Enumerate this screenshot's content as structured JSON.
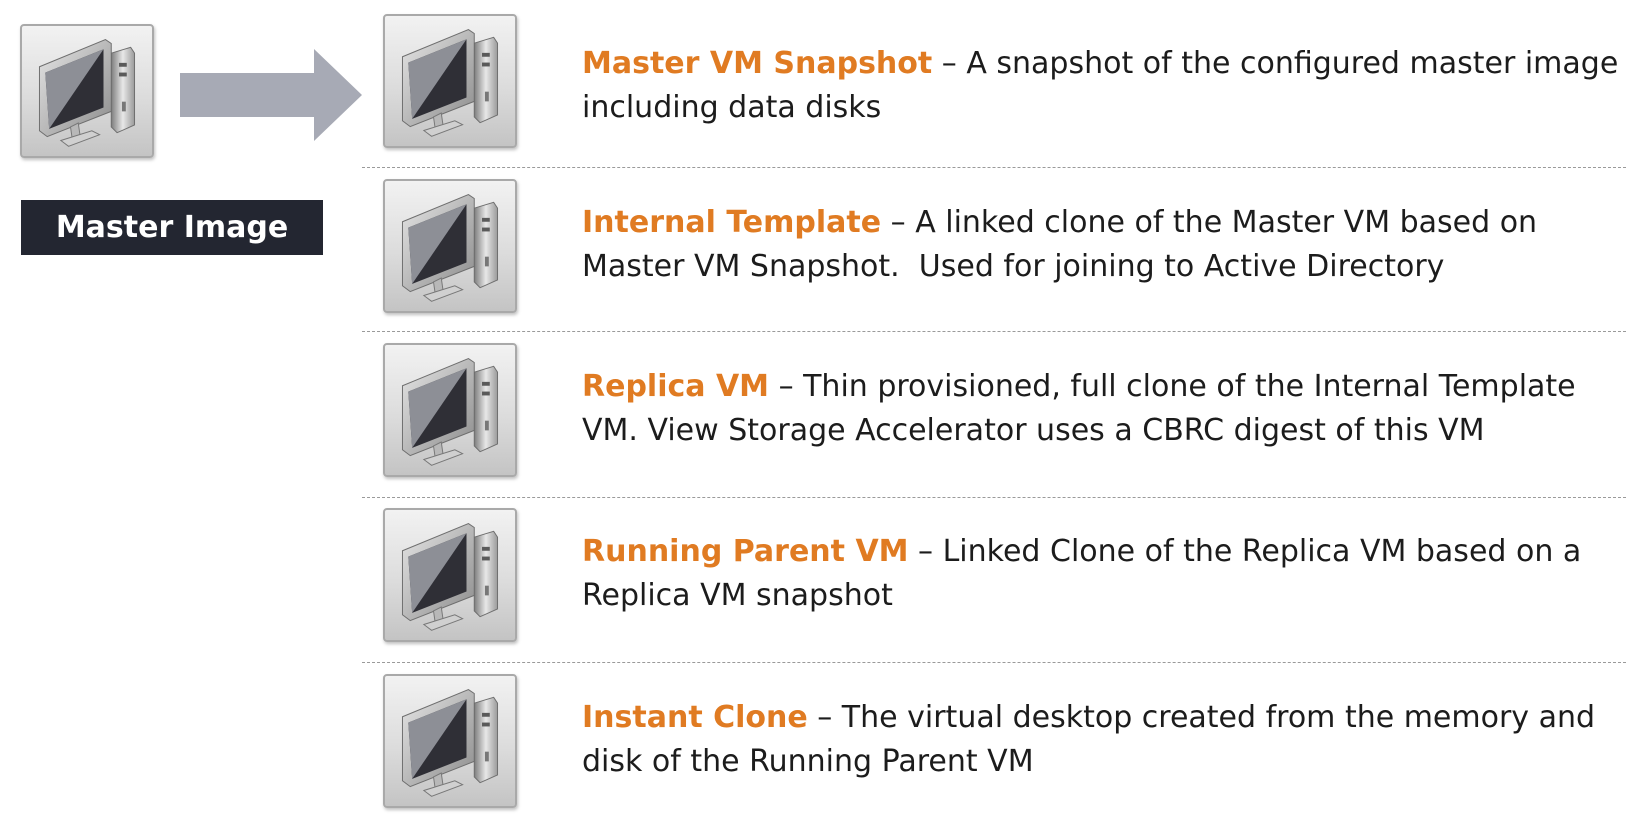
{
  "master": {
    "label": "Master Image",
    "icon": "computer-icon"
  },
  "items": [
    {
      "term": "Master VM Snapshot",
      "separator": " – ",
      "desc1": "A snapshot of the configured master image",
      "desc2": "including data disks"
    },
    {
      "term": "Internal Template",
      "separator": " – ",
      "desc1": "A linked clone of the Master VM based on",
      "desc2": "Master VM Snapshot.  Used for joining to Active Directory"
    },
    {
      "term": "Replica VM",
      "separator": " – ",
      "desc1": "Thin provisioned, full clone of the Internal Template",
      "desc2": "VM. View Storage Accelerator uses a CBRC digest of this VM"
    },
    {
      "term": "Running Parent VM",
      "separator": " – ",
      "desc1": "Linked Clone of the Replica VM based on a",
      "desc2": "Replica VM snapshot"
    },
    {
      "term": "Instant Clone",
      "separator": " – ",
      "desc1": "The virtual desktop created from the memory and",
      "desc2": "disk of the Running Parent VM"
    }
  ],
  "colors": {
    "term": "#e07b22",
    "badge_bg": "#232631",
    "arrow": "#a7aab5"
  }
}
